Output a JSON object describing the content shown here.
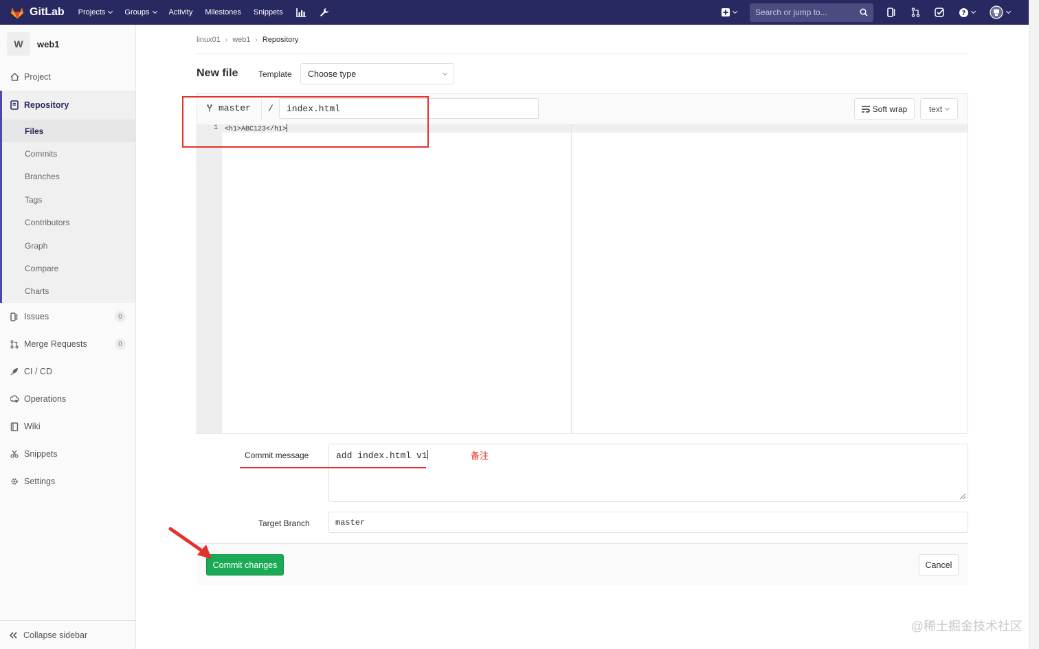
{
  "navbar": {
    "brand": "GitLab",
    "items": [
      {
        "label": "Projects",
        "dropdown": true
      },
      {
        "label": "Groups",
        "dropdown": true
      },
      {
        "label": "Activity",
        "dropdown": false
      },
      {
        "label": "Milestones",
        "dropdown": false
      },
      {
        "label": "Snippets",
        "dropdown": false
      }
    ],
    "search_placeholder": "Search or jump to...",
    "bg_color": "#292961"
  },
  "sidebar": {
    "avatar_letter": "W",
    "project_name": "web1",
    "items": [
      {
        "label": "Project",
        "icon": "home-icon"
      },
      {
        "label": "Repository",
        "icon": "repository-icon",
        "active": true
      },
      {
        "label": "Issues",
        "icon": "issues-icon",
        "count": "0"
      },
      {
        "label": "Merge Requests",
        "icon": "merge-request-icon",
        "count": "0"
      },
      {
        "label": "CI / CD",
        "icon": "rocket-icon"
      },
      {
        "label": "Operations",
        "icon": "cloud-gear-icon"
      },
      {
        "label": "Wiki",
        "icon": "book-icon"
      },
      {
        "label": "Snippets",
        "icon": "scissors-icon"
      },
      {
        "label": "Settings",
        "icon": "gear-icon"
      }
    ],
    "repo_sub": [
      "Files",
      "Commits",
      "Branches",
      "Tags",
      "Contributors",
      "Graph",
      "Compare",
      "Charts"
    ],
    "collapse": "Collapse sidebar"
  },
  "breadcrumb": [
    "linux01",
    "web1",
    "Repository"
  ],
  "page": {
    "title": "New file",
    "template_label": "Template",
    "template_value": "Choose type"
  },
  "editor": {
    "branch": "master",
    "slash": "/",
    "file_name": "index.html",
    "soft_wrap": "Soft wrap",
    "mode": "text",
    "line_number": "1",
    "content": "<h1>ABC123</h1>"
  },
  "commit": {
    "label": "Commit message",
    "message": "add index.html v1",
    "note": "备注",
    "target_label": "Target Branch",
    "target_value": "master",
    "commit_button": "Commit changes",
    "cancel_button": "Cancel",
    "commit_color": "#1aaa55"
  },
  "watermark": "@稀土掘金技术社区",
  "annotation_color": "#e4322b"
}
